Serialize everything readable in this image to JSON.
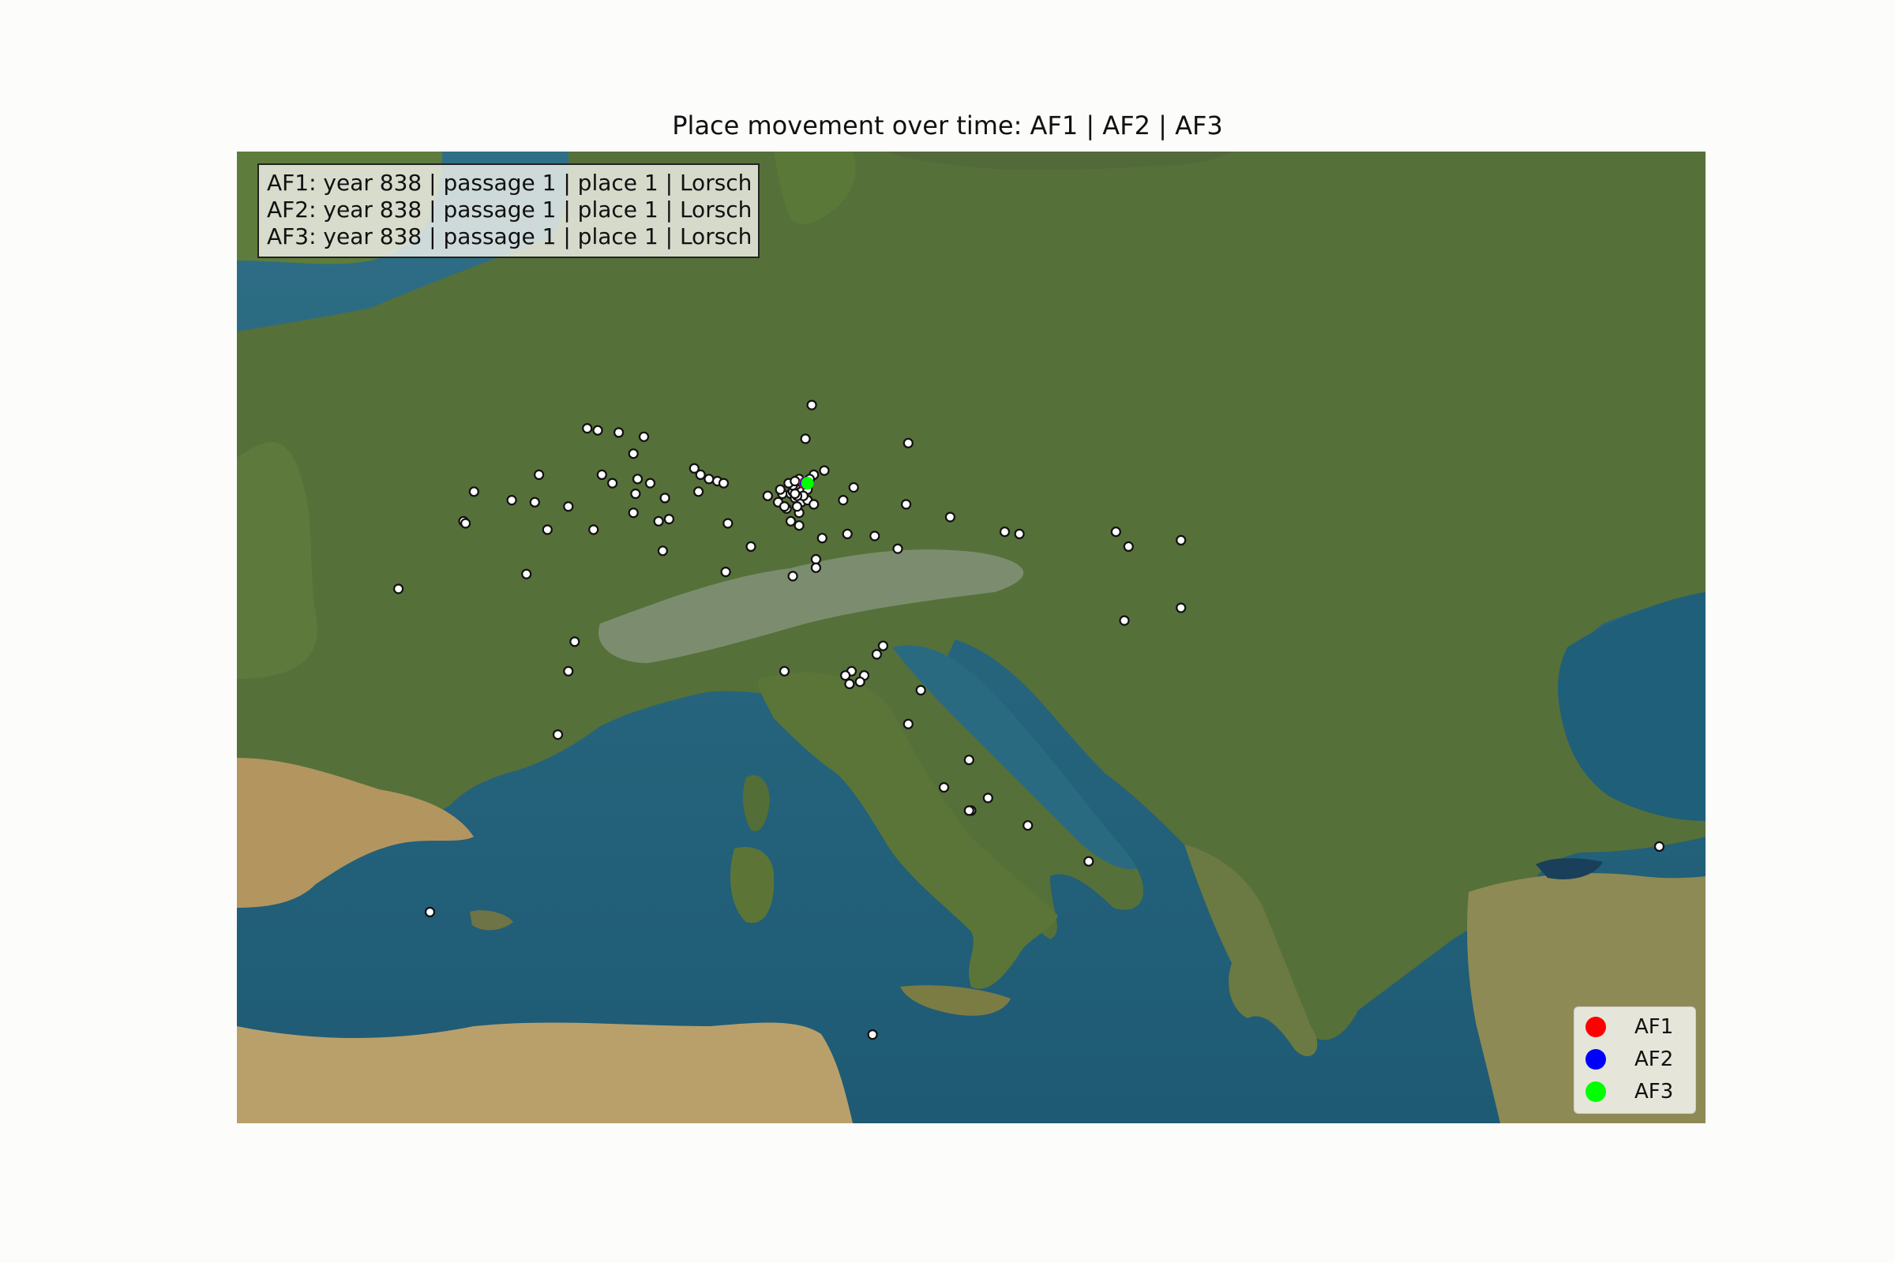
{
  "title": "Place movement over time: AF1 | AF2 | AF3",
  "info_box": {
    "lines": [
      "AF1: year 838 | passage 1 | place 1 | Lorsch",
      "AF2: year 838 | passage 1 | place 1 | Lorsch",
      "AF3: year 838 | passage 1 | place 1 | Lorsch"
    ]
  },
  "legend": {
    "placement": "lower-right",
    "items": [
      {
        "label": "AF1",
        "color": "#ff0000"
      },
      {
        "label": "AF2",
        "color": "#0000ff"
      },
      {
        "label": "AF3",
        "color": "#00ff00"
      }
    ]
  },
  "chart_data": {
    "type": "scatter",
    "basemap": "satellite imagery of Europe and the Mediterranean",
    "x_range": [
      -5,
      30
    ],
    "y_range": [
      34.5,
      57.5
    ],
    "current_positions": [
      {
        "series": "AF1",
        "place": "Lorsch",
        "lon": 8.57,
        "lat": 49.65,
        "color": "#ff0000"
      },
      {
        "series": "AF2",
        "place": "Lorsch",
        "lon": 8.57,
        "lat": 49.65,
        "color": "#0000ff"
      },
      {
        "series": "AF3",
        "place": "Lorsch",
        "lon": 8.57,
        "lat": 49.65,
        "color": "#00ff00"
      }
    ],
    "places": [
      [
        8.7,
        51.5
      ],
      [
        8.55,
        50.7
      ],
      [
        11.0,
        50.6
      ],
      [
        3.35,
        50.95
      ],
      [
        3.6,
        50.9
      ],
      [
        4.1,
        50.85
      ],
      [
        4.7,
        50.75
      ],
      [
        4.45,
        50.35
      ],
      [
        2.2,
        49.85
      ],
      [
        3.7,
        49.85
      ],
      [
        4.55,
        49.75
      ],
      [
        4.85,
        49.65
      ],
      [
        5.9,
        50.0
      ],
      [
        6.05,
        49.85
      ],
      [
        6.25,
        49.75
      ],
      [
        6.45,
        49.7
      ],
      [
        6.6,
        49.65
      ],
      [
        8.75,
        49.85
      ],
      [
        9.0,
        49.95
      ],
      [
        9.7,
        49.55
      ],
      [
        3.95,
        49.65
      ],
      [
        4.5,
        49.4
      ],
      [
        5.2,
        49.3
      ],
      [
        6.0,
        49.45
      ],
      [
        7.65,
        49.35
      ],
      [
        8.0,
        49.4
      ],
      [
        8.2,
        49.4
      ],
      [
        8.3,
        49.3
      ],
      [
        8.45,
        49.2
      ],
      [
        8.6,
        49.25
      ],
      [
        8.75,
        49.15
      ],
      [
        9.45,
        49.25
      ],
      [
        10.95,
        49.15
      ],
      [
        0.65,
        49.45
      ],
      [
        1.55,
        49.25
      ],
      [
        2.1,
        49.2
      ],
      [
        2.9,
        49.1
      ],
      [
        0.4,
        48.75
      ],
      [
        0.45,
        48.7
      ],
      [
        4.45,
        48.95
      ],
      [
        5.05,
        48.75
      ],
      [
        5.3,
        48.8
      ],
      [
        2.4,
        48.55
      ],
      [
        3.5,
        48.55
      ],
      [
        6.7,
        48.7
      ],
      [
        8.4,
        48.65
      ],
      [
        8.95,
        48.35
      ],
      [
        9.55,
        48.45
      ],
      [
        10.2,
        48.4
      ],
      [
        12.0,
        48.85
      ],
      [
        13.3,
        48.5
      ],
      [
        13.65,
        48.45
      ],
      [
        15.95,
        48.5
      ],
      [
        16.25,
        48.15
      ],
      [
        17.5,
        48.3
      ],
      [
        7.25,
        48.15
      ],
      [
        5.15,
        48.05
      ],
      [
        8.8,
        47.85
      ],
      [
        8.8,
        47.65
      ],
      [
        10.75,
        48.1
      ],
      [
        6.65,
        47.55
      ],
      [
        8.25,
        47.45
      ],
      [
        -1.15,
        47.15
      ],
      [
        1.9,
        47.5
      ],
      [
        16.15,
        46.4
      ],
      [
        17.5,
        46.7
      ],
      [
        3.05,
        45.9
      ],
      [
        10.25,
        45.6
      ],
      [
        2.9,
        45.2
      ],
      [
        8.05,
        45.2
      ],
      [
        10.4,
        45.8
      ],
      [
        9.65,
        45.2
      ],
      [
        9.5,
        45.1
      ],
      [
        9.95,
        45.1
      ],
      [
        9.6,
        44.9
      ],
      [
        9.85,
        44.95
      ],
      [
        11.3,
        44.75
      ],
      [
        11.0,
        43.95
      ],
      [
        2.65,
        43.7
      ],
      [
        12.45,
        43.1
      ],
      [
        11.85,
        42.45
      ],
      [
        12.9,
        42.2
      ],
      [
        12.5,
        41.9
      ],
      [
        12.45,
        41.9
      ],
      [
        13.85,
        41.55
      ],
      [
        -0.4,
        39.5
      ],
      [
        15.3,
        40.7
      ],
      [
        10.15,
        36.6
      ],
      [
        28.9,
        41.05
      ],
      [
        8.2,
        48.75
      ],
      [
        8.4,
        48.95
      ],
      [
        8.35,
        49.1
      ],
      [
        8.1,
        49.05
      ],
      [
        7.9,
        49.2
      ],
      [
        8.05,
        49.1
      ],
      [
        8.25,
        49.45
      ],
      [
        8.45,
        49.55
      ],
      [
        8.35,
        49.5
      ],
      [
        8.25,
        49.6
      ],
      [
        8.15,
        49.65
      ],
      [
        8.4,
        49.75
      ],
      [
        8.3,
        49.7
      ],
      [
        8.45,
        49.45
      ],
      [
        8.6,
        49.5
      ],
      [
        8.5,
        49.35
      ],
      [
        8.35,
        49.35
      ],
      [
        8.3,
        49.4
      ],
      [
        7.95,
        49.5
      ],
      [
        8.65,
        49.75
      ]
    ]
  }
}
